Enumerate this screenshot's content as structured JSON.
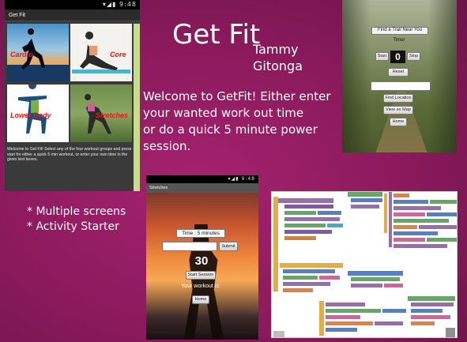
{
  "phone1": {
    "status_time": "9:48",
    "title": "Get Fit",
    "tiles": [
      {
        "label": "Cardio"
      },
      {
        "label": "Core"
      },
      {
        "label": "Lower Body"
      },
      {
        "label": "Stretches"
      }
    ],
    "description": "Welcome to Get Fit! Select any of the four workout groups and press start for either a quick 5 min workout, or enter your own time in the given text boxes."
  },
  "title": "Get Fit",
  "author_first": "Tammy",
  "author_last": "Gitonga",
  "welcome_lines": [
    "Welcome to GetFit! Either enter",
    "your wanted work out time",
    "or do a quick 5 minute power session."
  ],
  "phone2": {
    "find_trail_label": "Find a Trail Near You",
    "timer_label": "Timer",
    "start_label": "Start",
    "timer_value": "0",
    "stop_label": "Stop",
    "reset_label": "Reset",
    "find_location_label": "Find Location",
    "view_on_map_label": "View on Map",
    "home_label": "Home"
  },
  "bullets": [
    "* Multiple screens",
    "* Activity Starter"
  ],
  "phone3": {
    "status_time": "9:48",
    "title": "Stretches",
    "time_label": "Time : 5 minutes",
    "submit_label": "Submit",
    "countdown": "30",
    "start_session_label": "Start Session",
    "workout_label": "Your workout is:",
    "home_label": "Home"
  },
  "colors": {
    "background": "#8a1a5c",
    "tile_label": "#e81818"
  }
}
